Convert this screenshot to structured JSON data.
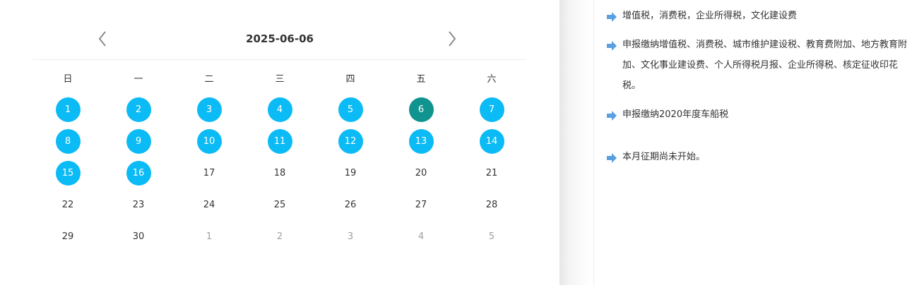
{
  "calendar": {
    "title": "2025-06-06",
    "prev_icon": "chevron-left-icon",
    "next_icon": "chevron-right-icon",
    "weekdays": [
      "日",
      "一",
      "二",
      "三",
      "四",
      "五",
      "六"
    ],
    "weeks": [
      [
        {
          "d": "1",
          "s": "filled"
        },
        {
          "d": "2",
          "s": "filled"
        },
        {
          "d": "3",
          "s": "filled"
        },
        {
          "d": "4",
          "s": "filled"
        },
        {
          "d": "5",
          "s": "filled"
        },
        {
          "d": "6",
          "s": "selected"
        },
        {
          "d": "7",
          "s": "filled"
        }
      ],
      [
        {
          "d": "8",
          "s": "filled"
        },
        {
          "d": "9",
          "s": "filled"
        },
        {
          "d": "10",
          "s": "filled"
        },
        {
          "d": "11",
          "s": "filled"
        },
        {
          "d": "12",
          "s": "filled"
        },
        {
          "d": "13",
          "s": "filled"
        },
        {
          "d": "14",
          "s": "filled"
        }
      ],
      [
        {
          "d": "15",
          "s": "filled"
        },
        {
          "d": "16",
          "s": "filled"
        },
        {
          "d": "17",
          "s": "normal"
        },
        {
          "d": "18",
          "s": "normal"
        },
        {
          "d": "19",
          "s": "normal"
        },
        {
          "d": "20",
          "s": "normal"
        },
        {
          "d": "21",
          "s": "normal"
        }
      ],
      [
        {
          "d": "22",
          "s": "normal"
        },
        {
          "d": "23",
          "s": "normal"
        },
        {
          "d": "24",
          "s": "normal"
        },
        {
          "d": "25",
          "s": "normal"
        },
        {
          "d": "26",
          "s": "normal"
        },
        {
          "d": "27",
          "s": "normal"
        },
        {
          "d": "28",
          "s": "normal"
        }
      ],
      [
        {
          "d": "29",
          "s": "normal"
        },
        {
          "d": "30",
          "s": "normal"
        },
        {
          "d": "1",
          "s": "other"
        },
        {
          "d": "2",
          "s": "other"
        },
        {
          "d": "3",
          "s": "other"
        },
        {
          "d": "4",
          "s": "other"
        },
        {
          "d": "5",
          "s": "other"
        }
      ]
    ],
    "colors": {
      "filled": "#0bbbf5",
      "selected": "#0f9490",
      "other_month_text": "#a0a0a0"
    }
  },
  "notices": {
    "icon": "arrow-right-icon",
    "icon_color": "#5aa0e0",
    "items": [
      "增值税，消费税，企业所得税，文化建设费",
      "申报缴纳增值税、消费税、城市维护建设税、教育费附加、地方教育附加、文化事业建设费、个人所得税月报、企业所得税、核定征收印花税。",
      "申报缴纳2020年度车船税",
      "本月征期尚未开始。"
    ]
  }
}
